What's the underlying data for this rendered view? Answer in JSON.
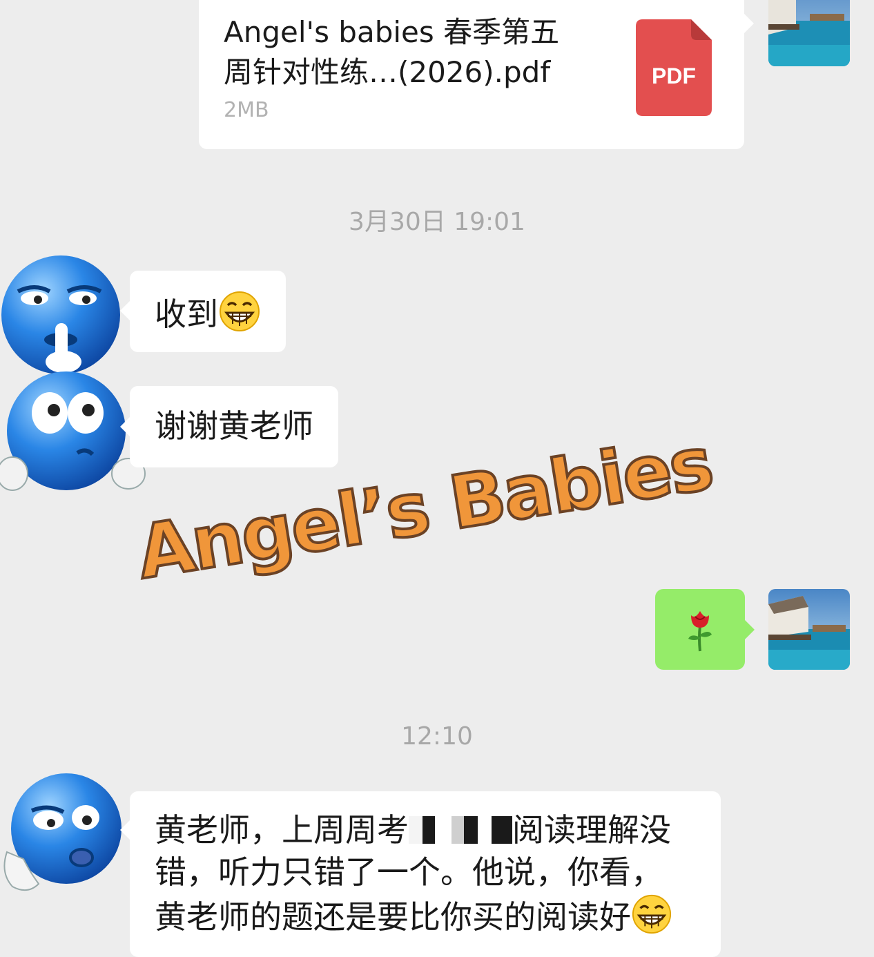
{
  "file_message": {
    "name_line1": "Angel's babies 春季第五",
    "name_line2": "周针对性练…(2026).pdf",
    "size": "2MB",
    "icon_label": "PDF",
    "icon_color": "#e34f4f"
  },
  "timestamps": [
    "3月30日 19:01",
    "12:10"
  ],
  "messages": [
    {
      "sender": "other",
      "text": "收到",
      "emoji": "grinning-face-icon"
    },
    {
      "sender": "other",
      "text": "谢谢黄老师"
    },
    {
      "sender": "self",
      "emoji": "rose-icon"
    },
    {
      "sender": "other",
      "line1": "黄老师，上周周考",
      "line1b": "阅读理解没",
      "line2": "错，听力只错了一个。他说，你看，",
      "line3": "黄老师的题还是要比你买的阅读好",
      "emoji": "grinning-face-icon"
    }
  ],
  "watermark": "Angel’s Babies",
  "colors": {
    "background": "#ededed",
    "bubble_self": "#95ec69",
    "bubble_other": "#ffffff",
    "watermark_fill": "#f0963a",
    "watermark_stroke": "#6b4225"
  }
}
